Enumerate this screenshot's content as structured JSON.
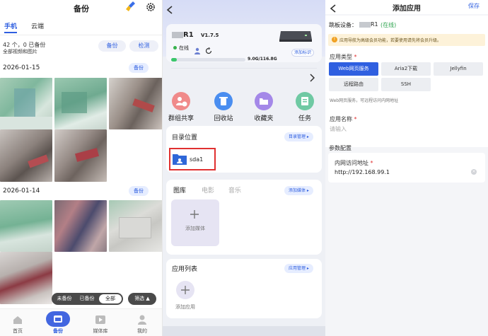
{
  "left": {
    "title": "备份",
    "tabs": [
      "手机",
      "云端"
    ],
    "status_line": "42 个，0 已备份",
    "status_sub": "全部视频和图片",
    "backup_btn": "备份",
    "check_btn": "检测",
    "date1": "2026-01-15",
    "date2": "2026-01-14",
    "group_backup": "备份",
    "filters": [
      "未备份",
      "已备份",
      "全部"
    ],
    "filter_active": "全部",
    "filter_btn": "筛选 ▲",
    "nav": [
      "首页",
      "备份",
      "媒体库",
      "我的"
    ]
  },
  "middle": {
    "device_name": "R1",
    "version": "V1.7.5",
    "status": "在线",
    "add_tag": "添加标识",
    "storage": "9.0G/116.8G",
    "storage_fraction": 0.077,
    "actions": [
      "群组共享",
      "回收站",
      "收藏夹",
      "任务"
    ],
    "dir_title": "目录位置",
    "dir_manage": "目录管理",
    "folder": "sda1",
    "media_tabs": [
      "图库",
      "电影",
      "音乐"
    ],
    "add_media_btn": "添加媒体",
    "add_media": "添加媒体",
    "app_list_title": "应用列表",
    "app_manage": "应用管理",
    "add_app": "添加应用"
  },
  "right": {
    "title": "添加应用",
    "save": "保存",
    "jump_label": "跳板设备：",
    "jump_device": "R1",
    "jump_status": "(在线)",
    "notice": "应用导航为高级会员功能，若要使用请先将会员升级。",
    "type_label": "应用类型",
    "types": [
      "Web网页服务",
      "Aria2下载",
      "Jellyfin",
      "远程路由",
      "SSH"
    ],
    "type_hint": "Web网页服务，可远程访问内网地址",
    "name_label": "应用名称",
    "name_placeholder": "请输入",
    "params_label": "参数配置",
    "url_label": "内网访问地址",
    "url_value": "http://192.168.99.1",
    "required": "*"
  }
}
